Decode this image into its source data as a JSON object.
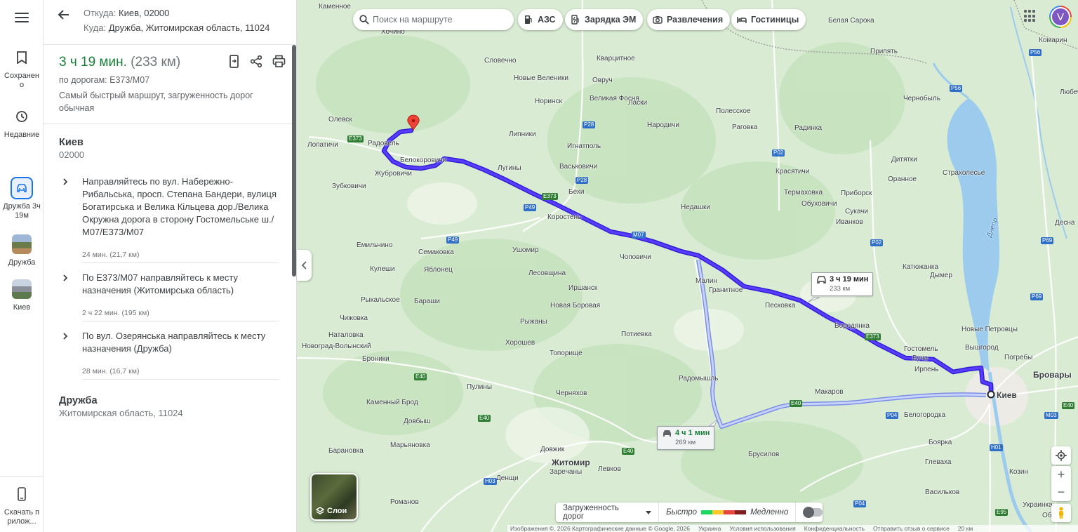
{
  "rail": {
    "saved": "Сохранено",
    "recent": "Недавние",
    "trip": "Дружба 3ч 19м",
    "recent_place_1": "Дружба",
    "recent_place_2": "Киев",
    "download": "Скачать прилож..."
  },
  "route": {
    "from_key": "Откуда:",
    "from": "Киев, 02000",
    "to_key": "Куда:",
    "to": "Дружба, Житомирская область, 11024",
    "time": "3 ч 19 мин.",
    "distance": "(233 км)",
    "via": "по дорогам: E373/M07",
    "description": "Самый быстрый маршрут, загруженность дорог обычная"
  },
  "start": {
    "name": "Киев",
    "sub": "02000"
  },
  "steps": [
    {
      "text": "Направляйтесь по вул. Набережно-Рибальська, просп. Степана Бандери, вулиця Богатирська и Велика Кільцева дор./Велика Окружна дорога в сторону Гостомельське ш./М07/E373/M07",
      "meta": "24 мин. (21,7 км)"
    },
    {
      "text": "По E373/M07 направляйтесь к месту назначения (Житомирська область)",
      "meta": "2 ч 22 мин. (195 км)"
    },
    {
      "text": "По вул. Озерянська направляйтесь к месту назначения (Дружба)",
      "meta": "28 мин. (16,7 км)"
    }
  ],
  "end": {
    "name": "Дружба",
    "sub": "Житомирская область, 11024"
  },
  "search": {
    "placeholder": "Поиск на маршруте"
  },
  "chips": [
    "АЗС",
    "Зарядка ЭМ",
    "Развлечения",
    "Гостиницы"
  ],
  "account_initial": "V",
  "main_box": {
    "time": "3 ч 19 мин",
    "dist": "233 км"
  },
  "alt_box": {
    "time": "4 ч 1 мин",
    "dist": "269 км"
  },
  "layers_label": "Слои",
  "traffic": {
    "label": "Загруженность дорог",
    "fast": "Быстро",
    "slow": "Медленно"
  },
  "footer": [
    "Изображения ©, 2026 Картографические данные © Google, 2026",
    "Украина",
    "Условия использования",
    "Конфиденциальность",
    "Отправить отзыв о сервисе",
    "20 км"
  ],
  "map_labels": [
    [
      "Каменное",
      454,
      10
    ],
    [
      "Хочино",
      543,
      46
    ],
    [
      "Словечно",
      690,
      87
    ],
    [
      "Кварцитное",
      850,
      84
    ],
    [
      "Новые Веленики",
      732,
      112
    ],
    [
      "Овруч",
      844,
      115
    ],
    [
      "Норинск",
      762,
      145
    ],
    [
      "Великая Фосня",
      840,
      141
    ],
    [
      "Ласки",
      895,
      147
    ],
    [
      "Полесское",
      1020,
      159
    ],
    [
      "Олевск",
      468,
      171
    ],
    [
      "Народичи",
      922,
      179
    ],
    [
      "Раговка",
      1043,
      182
    ],
    [
      "Радинка",
      1132,
      183
    ],
    [
      "Липники",
      725,
      192
    ],
    [
      "Радовель",
      524,
      205
    ],
    [
      "Лопатичи",
      438,
      207
    ],
    [
      "Игнатполь",
      808,
      209
    ],
    [
      "Белокоровичи",
      570,
      229
    ],
    [
      "Дитятки",
      1270,
      228
    ],
    [
      "Лугины",
      709,
      240
    ],
    [
      "Васьковичи",
      797,
      238
    ],
    [
      "Красятичи",
      1105,
      245
    ],
    [
      "Страхолесье",
      1343,
      247
    ],
    [
      "Жубровичи",
      534,
      248
    ],
    [
      "Зубковичи",
      473,
      266
    ],
    [
      "Бехи",
      810,
      274
    ],
    [
      "Термаховка",
      1117,
      275
    ],
    [
      "Оранное",
      1265,
      256
    ],
    [
      "Приборск",
      1198,
      276
    ],
    [
      "Обуховичи",
      1142,
      291
    ],
    [
      "Недашки",
      970,
      296
    ],
    [
      "Сукачи",
      1204,
      302
    ],
    [
      "Коростень",
      780,
      310
    ],
    [
      "Иванков",
      1191,
      317
    ],
    [
      "Десна",
      1503,
      318
    ],
    [
      "Емильчино",
      508,
      350
    ],
    [
      "Семаковка",
      596,
      360
    ],
    [
      "Ушомир",
      730,
      357
    ],
    [
      "Чоповичи",
      883,
      367
    ],
    [
      "Катюжанка",
      1286,
      381
    ],
    [
      "Кулеши",
      527,
      384
    ],
    [
      "Яблонец",
      604,
      385
    ],
    [
      "Лесовщина",
      753,
      390
    ],
    [
      "Дымер",
      1325,
      393
    ],
    [
      "Малин",
      991,
      401
    ],
    [
      "Гранитное",
      1010,
      414
    ],
    [
      "Иршанск",
      810,
      411
    ],
    [
      "Рыкальское",
      514,
      428
    ],
    [
      "Бараши",
      590,
      430
    ],
    [
      "Новая Боровая",
      784,
      436
    ],
    [
      "Песковка",
      1090,
      436
    ],
    [
      "Чижовка",
      484,
      454
    ],
    [
      "Рыжаны",
      741,
      459
    ],
    [
      "Бородянка",
      1189,
      465
    ],
    [
      "Новые Петровцы",
      1370,
      470
    ],
    [
      "Наталовка",
      468,
      478
    ],
    [
      "Потиевка",
      885,
      477
    ],
    [
      "Новоград-Волынский",
      430,
      494
    ],
    [
      "Хорошев",
      720,
      489
    ],
    [
      "Вышгород",
      1375,
      496
    ],
    [
      "Гостомель",
      1288,
      498
    ],
    [
      "Топорище",
      783,
      504
    ],
    [
      "Бровары",
      1472,
      533
    ],
    [
      "Броники",
      516,
      512
    ],
    [
      "Ирпень",
      1303,
      527
    ],
    [
      "Буча",
      1300,
      511
    ],
    [
      "Погребы",
      1431,
      510
    ],
    [
      "Радомышль",
      967,
      540
    ],
    [
      "Пулины",
      665,
      552
    ],
    [
      "Макаров",
      1161,
      559
    ],
    [
      "Черняхов",
      792,
      561
    ],
    [
      "Каменный Брод",
      522,
      574
    ],
    [
      "Белогородка",
      1288,
      592
    ],
    [
      "Довбыш",
      575,
      601
    ],
    [
      "Боярка",
      1323,
      631
    ],
    [
      "Барановка",
      468,
      643
    ],
    [
      "Марьяновка",
      556,
      635
    ],
    [
      "Довжик",
      770,
      641
    ],
    [
      "Брусилов",
      1066,
      648
    ],
    [
      "Житомир",
      786,
      658
    ],
    [
      "Зарeчаны",
      783,
      673
    ],
    [
      "Левков",
      852,
      669
    ],
    [
      "Глеваха",
      1318,
      659
    ],
    [
      "Козин",
      1438,
      673
    ],
    [
      "Денщи",
      707,
      682
    ],
    [
      "Васильков",
      1318,
      702
    ],
    [
      "Романов",
      556,
      716
    ],
    [
      "Украинка",
      1457,
      720
    ],
    [
      "Обухов",
      1485,
      735
    ],
    [
      "Белая Сарока",
      1180,
      30
    ],
    [
      "Комарин",
      1480,
      58
    ],
    [
      "Припять",
      1240,
      74
    ],
    [
      "Чернобыль",
      1287,
      141
    ],
    [
      "Любеч",
      1510,
      132
    ],
    [
      "Днепр",
      1400,
      325
    ],
    [
      "Киев",
      1420,
      562
    ]
  ],
  "road_shields": [
    [
      "E373",
      495,
      198
    ],
    [
      "P28",
      830,
      178
    ],
    [
      "P02",
      1100,
      218
    ],
    [
      "P28",
      820,
      257
    ],
    [
      "E373",
      772,
      280
    ],
    [
      "P49",
      746,
      296
    ],
    [
      "M07",
      900,
      335
    ],
    [
      "P49",
      636,
      342
    ],
    [
      "P02",
      1240,
      346
    ],
    [
      "P69",
      1483,
      343
    ],
    [
      "P56",
      1353,
      126
    ],
    [
      "P56",
      1466,
      75
    ],
    [
      "P69",
      1468,
      423
    ],
    [
      "E373",
      1232,
      480
    ],
    [
      "E40",
      590,
      537
    ],
    [
      "E40",
      1125,
      575
    ],
    [
      "E40",
      681,
      596
    ],
    [
      "P04",
      1262,
      592
    ],
    [
      "M03",
      1488,
      592
    ],
    [
      "E40",
      886,
      643
    ],
    [
      "H03",
      689,
      686
    ],
    [
      "H01",
      1410,
      638
    ],
    [
      "E95",
      1418,
      730
    ],
    [
      "P04",
      1216,
      718
    ],
    [
      "E40",
      1513,
      578
    ]
  ],
  "colors": {
    "route": "#4b2bf0",
    "alt_route": "#9aa8f0",
    "accent": "#1a73e8",
    "time_green": "#188038"
  }
}
